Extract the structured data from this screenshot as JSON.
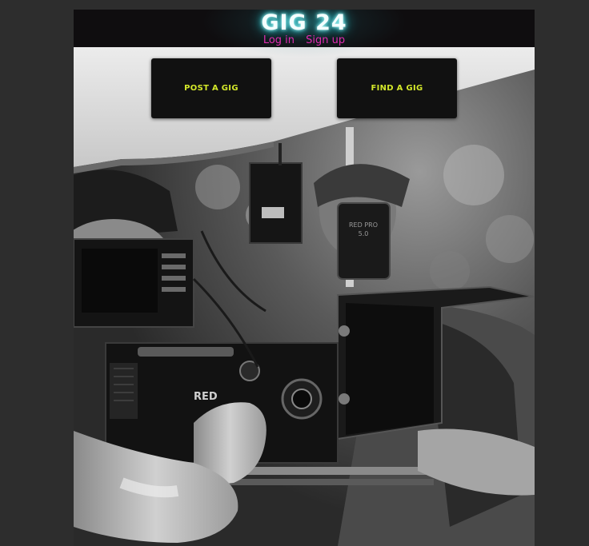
{
  "header": {
    "brand": "GIG 24",
    "login_label": "Log in",
    "signup_label": "Sign up"
  },
  "actions": {
    "post_label": "POST A GIG",
    "find_label": "FIND A GIG"
  },
  "hero": {
    "image_description": "black-and-white film camera crew photo",
    "visible_text": {
      "camera_brand": "RED",
      "monitor_label_line1": "RED PRO",
      "monitor_label_line2": "5.0"
    }
  },
  "colors": {
    "page_bg": "#2d2d2d",
    "header_bg": "#0f0d0f",
    "brand_glow": "#35e0e6",
    "auth_links": "#e02bb0",
    "cta_bg": "#111111",
    "cta_text": "#d4e82a"
  }
}
